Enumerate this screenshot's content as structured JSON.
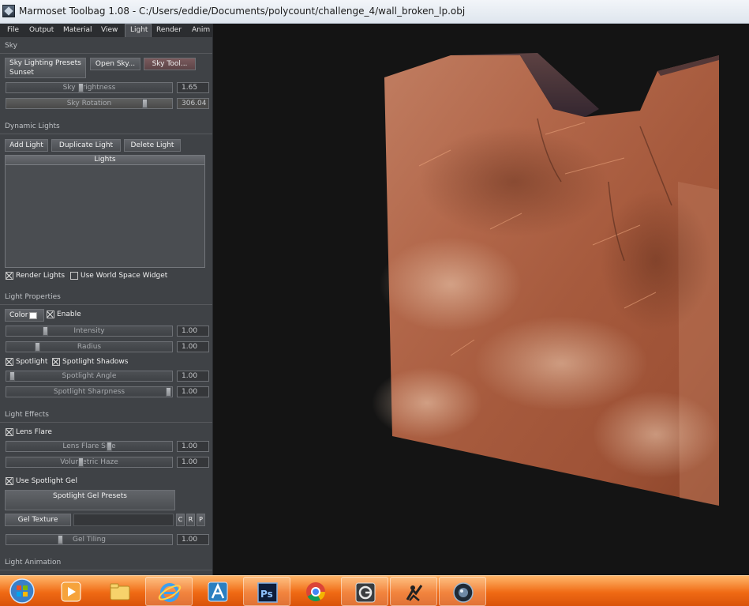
{
  "window": {
    "title": "Marmoset Toolbag 1.08 - C:/Users/eddie/Documents/polycount/challenge_4/wall_broken_lp.obj"
  },
  "menu": {
    "items": [
      "File",
      "Output",
      "Material",
      "View",
      "Light",
      "Render",
      "Anim"
    ],
    "active": "Light"
  },
  "sky": {
    "header": "Sky",
    "presets_button": "Sky Lighting Presets",
    "preset_value": "Sunset",
    "open_sky_button": "Open Sky...",
    "sky_tool_button": "Sky Tool...",
    "brightness": {
      "label": "Sky Brightness",
      "value": "1.65",
      "level": 0.45
    },
    "rotation": {
      "label": "Sky Rotation",
      "value": "306.04",
      "level": 0.85
    }
  },
  "dynamic_lights": {
    "header": "Dynamic Lights",
    "add_button": "Add Light",
    "duplicate_button": "Duplicate Light",
    "delete_button": "Delete Light",
    "list_header": "Lights",
    "render_lights": {
      "label": "Render Lights",
      "checked": true
    },
    "world_space_widget": {
      "label": "Use World Space Widget",
      "checked": false
    }
  },
  "light_properties": {
    "header": "Light Properties",
    "color_button": "Color",
    "swatch_color": "#ffffff",
    "enable": {
      "label": "Enable",
      "checked": true
    },
    "intensity": {
      "label": "Intensity",
      "value": "1.00",
      "level": 0.23
    },
    "radius": {
      "label": "Radius",
      "value": "1.00",
      "level": 0.18
    },
    "spotlight": {
      "label": "Spotlight",
      "checked": true
    },
    "spotlight_shadows": {
      "label": "Spotlight Shadows",
      "checked": true
    },
    "spotlight_angle": {
      "label": "Spotlight Angle",
      "value": "1.00",
      "level": 0.02
    },
    "spotlight_sharpness": {
      "label": "Spotlight Sharpness",
      "value": "1.00",
      "level": 1.0
    }
  },
  "light_effects": {
    "header": "Light Effects",
    "lens_flare": {
      "label": "Lens Flare",
      "checked": true
    },
    "lens_flare_size": {
      "label": "Lens Flare Size",
      "value": "1.00",
      "level": 0.63
    },
    "volumetric_haze": {
      "label": "Volumetric Haze",
      "value": "1.00",
      "level": 0.45
    },
    "use_spotlight_gel": {
      "label": "Use Spotlight Gel",
      "checked": true
    },
    "gel_presets_button": "Spotlight Gel Presets",
    "gel_texture_button": "Gel Texture",
    "c_button": "C",
    "r_button": "R",
    "p_button": "P",
    "gel_tiling": {
      "label": "Gel Tiling",
      "value": "1.00",
      "level": 0.32
    }
  },
  "light_animation": {
    "header": "Light Animation"
  },
  "taskbar": {
    "apps": [
      "start-orb",
      "media-player",
      "file-explorer",
      "internet-explorer",
      "autodesk-app",
      "photoshop",
      "chrome",
      "3ds-max",
      "zbrush",
      "marmoset-toolbag"
    ],
    "active": [
      "internet-explorer",
      "photoshop",
      "3ds-max",
      "zbrush",
      "marmoset-toolbag"
    ]
  }
}
